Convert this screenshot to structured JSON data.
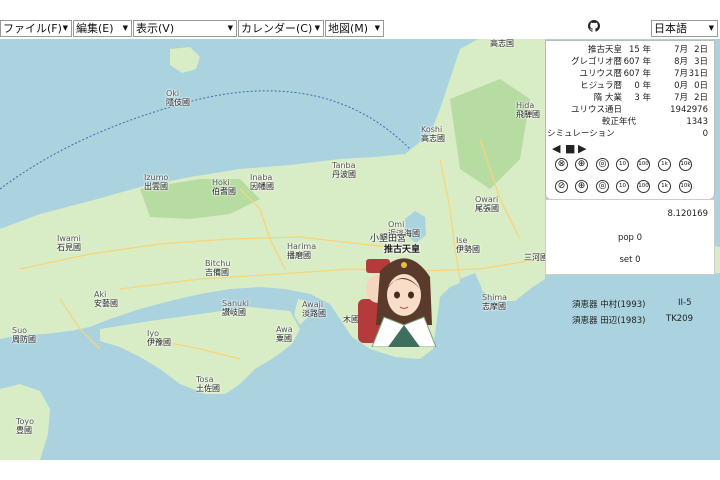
{
  "menu": {
    "file": "ファイル(F)",
    "edit": "編集(E)",
    "view": "表示(V)",
    "calendar": "カレンダー(C)",
    "map": "地図(M)",
    "language": "日本語"
  },
  "info": {
    "rows": [
      {
        "label": "推古天皇",
        "a": "15 年",
        "b": "7月",
        "c": "2日"
      },
      {
        "label": "グレゴリオ暦",
        "a": "607 年",
        "b": "8月",
        "c": "3日"
      },
      {
        "label": "ユリウス暦",
        "a": "607 年",
        "b": "7月",
        "c": "31日"
      },
      {
        "label": "ヒジュラ暦",
        "a": "0 年",
        "b": "0月",
        "c": "0日"
      },
      {
        "label": "隋 大業",
        "a": "3 年",
        "b": "7月",
        "c": "2日"
      }
    ],
    "julian_day_label": "ユリウス通日",
    "julian_day_value": "1942976",
    "corrected_year_label": "較正年代",
    "corrected_year_value": "1343",
    "simulation_label": "シミュレーション",
    "simulation_value": "0",
    "speed_row1": [
      "⊗",
      "⊕",
      "◎",
      "10",
      "100",
      "1k",
      "10k"
    ],
    "speed_row2": [
      "⊘",
      "⊕",
      "◎",
      "10",
      "100",
      "1k",
      "10k"
    ]
  },
  "sim": {
    "value": "8.120169",
    "pop": "pop 0",
    "set": "set 0"
  },
  "pottery": [
    {
      "name": "須恵器 中村(1993)",
      "code": "II-5"
    },
    {
      "name": "須恵器 田辺(1983)",
      "code": "TK209"
    }
  ],
  "map_labels": [
    {
      "r": "Oki",
      "n": "隱伎國"
    },
    {
      "r": "Izumo",
      "n": "出雲國"
    },
    {
      "r": "Hoki",
      "n": "伯耆國"
    },
    {
      "r": "Inaba",
      "n": "因幡國"
    },
    {
      "r": "Tanba",
      "n": "丹波國"
    },
    {
      "r": "Iwami",
      "n": "石見國"
    },
    {
      "r": "Bitchu",
      "n": "吉備國"
    },
    {
      "r": "Harima",
      "n": "播磨國"
    },
    {
      "r": "Aki",
      "n": "安藝國"
    },
    {
      "r": "Sanuki",
      "n": "讃岐國"
    },
    {
      "r": "Awaji",
      "n": "淡路國"
    },
    {
      "r": "Awa",
      "n": "粟國"
    },
    {
      "r": "Suo",
      "n": "周防國"
    },
    {
      "r": "Iyo",
      "n": "伊豫國"
    },
    {
      "r": "Tosa",
      "n": "土佐國"
    },
    {
      "r": "Toyo",
      "n": "豊國"
    },
    {
      "r": "Koshi",
      "n": "高志國"
    },
    {
      "r": "Owari",
      "n": "尾張國"
    },
    {
      "r": "Omi",
      "n": "近淡海國"
    },
    {
      "r": "Ise",
      "n": "伊勢國"
    },
    {
      "r": "Shima",
      "n": "志摩國"
    },
    {
      "r": "Hida",
      "n": "飛騨國"
    },
    {
      "r": "",
      "n": "三河國"
    },
    {
      "r": "",
      "n": "木國"
    },
    {
      "r": "",
      "n": "高志国"
    }
  ],
  "map_places": {
    "capital": "推古天皇",
    "capital_prefix": "小墾田宮"
  },
  "colors": {
    "sea": "#aad3df",
    "land": "#d8ecc6",
    "land_dark": "#b7dca2",
    "road": "#f6d57a"
  },
  "icons": {
    "github": "github-icon",
    "empress": "empress-avatar"
  }
}
